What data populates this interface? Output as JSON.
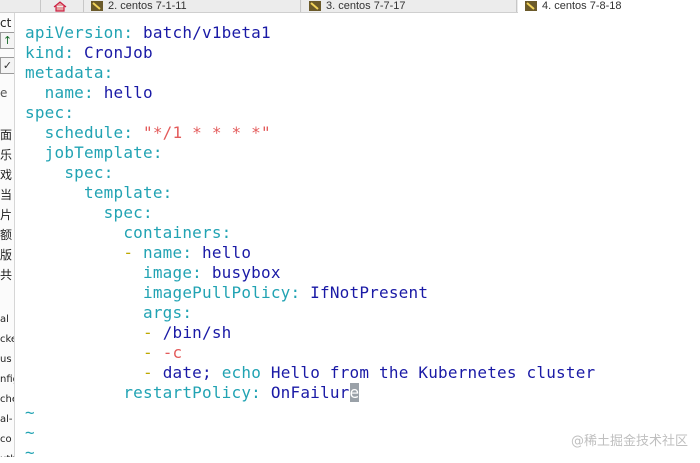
{
  "tabs": [
    {
      "label": "2. centos 7-1-11"
    },
    {
      "label": "3. centos 7-7-17"
    },
    {
      "label": "4. centos 7-8-18"
    }
  ],
  "sidebar": {
    "top_text": "ct",
    "items": [
      "面",
      "乐",
      "戏",
      "当",
      "片",
      "额",
      "版",
      "共",
      "al",
      "cke",
      "us",
      "nfig",
      "che",
      "al-",
      "co",
      "uth"
    ]
  },
  "editor": {
    "line1": {
      "key": "apiVersion",
      "value": "batch/v1beta1"
    },
    "line2": {
      "key": "kind",
      "value": "CronJob"
    },
    "line3": {
      "key": "metadata"
    },
    "line4": {
      "key": "name",
      "value": "hello"
    },
    "line5": {
      "key": "spec"
    },
    "line6": {
      "key": "schedule",
      "value": "\"*/1 * * * *\""
    },
    "line7": {
      "key": "jobTemplate"
    },
    "line8": {
      "key": "spec"
    },
    "line9": {
      "key": "template"
    },
    "line10": {
      "key": "spec"
    },
    "line11": {
      "key": "containers"
    },
    "line12": {
      "dash": "-",
      "key": "name",
      "value": "hello"
    },
    "line13": {
      "key": "image",
      "value": "busybox"
    },
    "line14": {
      "key": "imagePullPolicy",
      "value": "IfNotPresent"
    },
    "line15": {
      "key": "args"
    },
    "line16": {
      "dash": "-",
      "value": "/bin/sh"
    },
    "line17": {
      "dash": "-",
      "value": "-c"
    },
    "line18": {
      "dash": "-",
      "value_a": "date;",
      "echo": "echo",
      "value_b": "Hello from the Kubernetes cluster"
    },
    "line19": {
      "key": "restartPolicy",
      "value": "OnFailur",
      "cursor_char": "e"
    },
    "tilde": "~"
  },
  "watermark": "@稀土掘金技术社区",
  "colors": {
    "key": "#21a3b3",
    "value": "#1a1aa6",
    "string": "#e35b5b",
    "dash": "#bda800"
  }
}
